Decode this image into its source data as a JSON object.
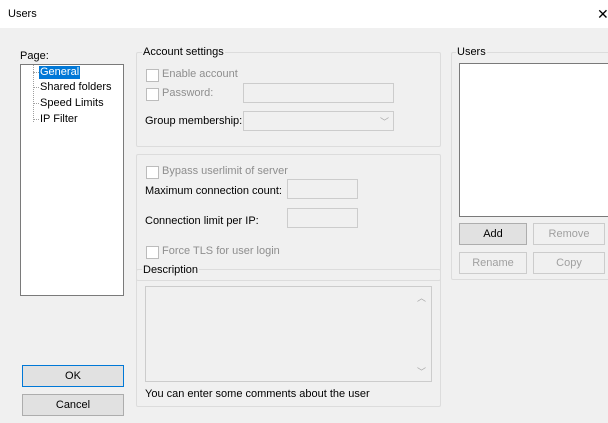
{
  "window": {
    "title": "Users"
  },
  "page_panel": {
    "label": "Page:",
    "items": [
      "General",
      "Shared folders",
      "Speed Limits",
      "IP Filter"
    ],
    "selected": "General"
  },
  "account": {
    "group_label": "Account settings",
    "enable_account": "Enable account",
    "password_label": "Password:",
    "password_value": "",
    "group_membership_label": "Group membership:",
    "group_membership_value": ""
  },
  "limits": {
    "bypass_label": "Bypass userlimit of server",
    "max_conn_label": "Maximum connection count:",
    "max_conn_value": "",
    "conn_per_ip_label": "Connection limit per IP:",
    "conn_per_ip_value": "",
    "force_tls_label": "Force TLS for user login"
  },
  "description": {
    "group_label": "Description",
    "value": "",
    "hint": "You can enter some comments about the user"
  },
  "users": {
    "group_label": "Users",
    "add_label": "Add",
    "remove_label": "Remove",
    "rename_label": "Rename",
    "copy_label": "Copy"
  },
  "buttons": {
    "ok_label": "OK",
    "cancel_label": "Cancel"
  },
  "colors": {
    "selection": "#0078d7",
    "dialog_bg": "#f0f0f0",
    "disabled_text": "#8e8e8e"
  }
}
